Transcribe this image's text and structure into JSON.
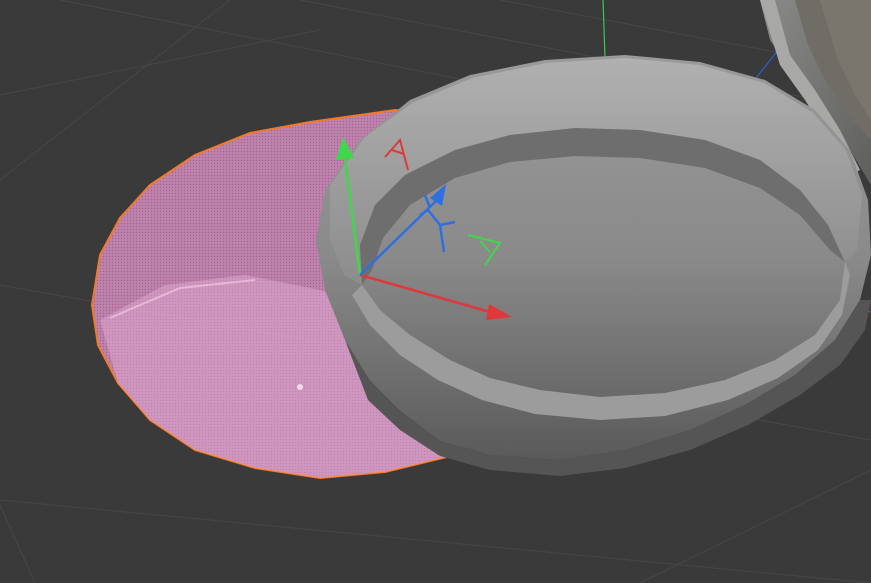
{
  "viewport": {
    "background": "#3a3a3a",
    "grid_color": "#4a4a4a"
  },
  "axes": {
    "x_color": "#e0383a",
    "y_color": "#3fd84a",
    "z_color": "#2f6fe0"
  },
  "selection": {
    "outline_color": "#f07a2a",
    "fill_color": "#d98cc2"
  },
  "objects": {
    "selected": "disc-mesh",
    "other": [
      "ring-mesh",
      "background-mesh"
    ]
  },
  "gizmo": {
    "type": "move",
    "handles": [
      "x-arrow",
      "y-arrow",
      "z-arrow",
      "xy-plane",
      "yz-plane",
      "xz-plane"
    ]
  }
}
